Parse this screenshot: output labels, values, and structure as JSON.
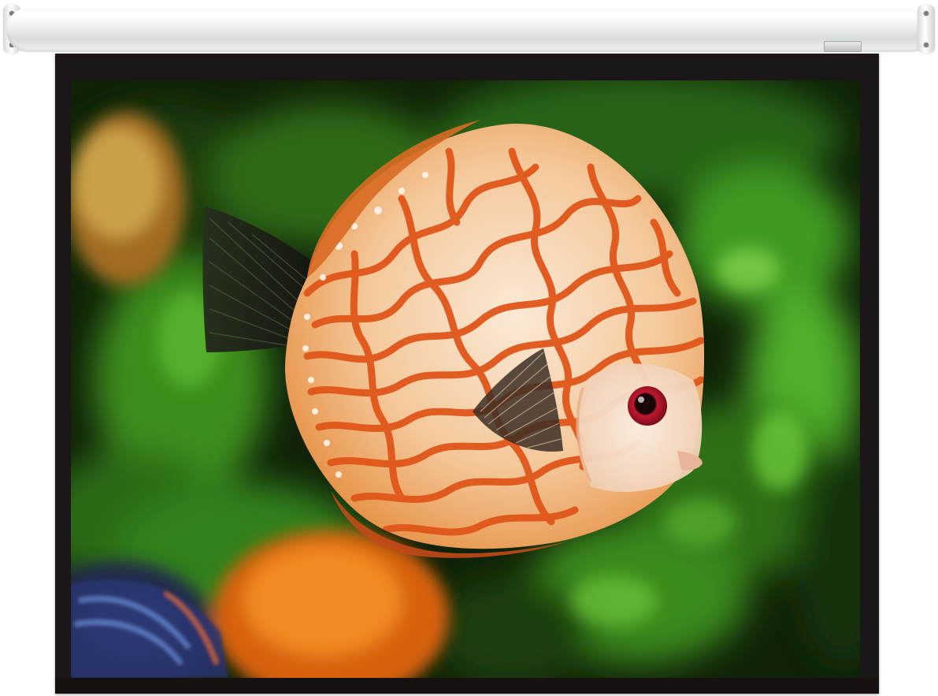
{
  "scene": {
    "subject": "fish-icon",
    "colors": {
      "background_dark": "#0f1d0a",
      "foliage": "#3a8a1f",
      "foliage_light": "#6cc83a",
      "fish_orange": "#e25a12",
      "fish_cream": "#f6e3cf",
      "fish_eye": "#b0122a",
      "fin_dark": "#1c1a14",
      "frame": "#1b1618",
      "housing": "#eceeee"
    }
  }
}
